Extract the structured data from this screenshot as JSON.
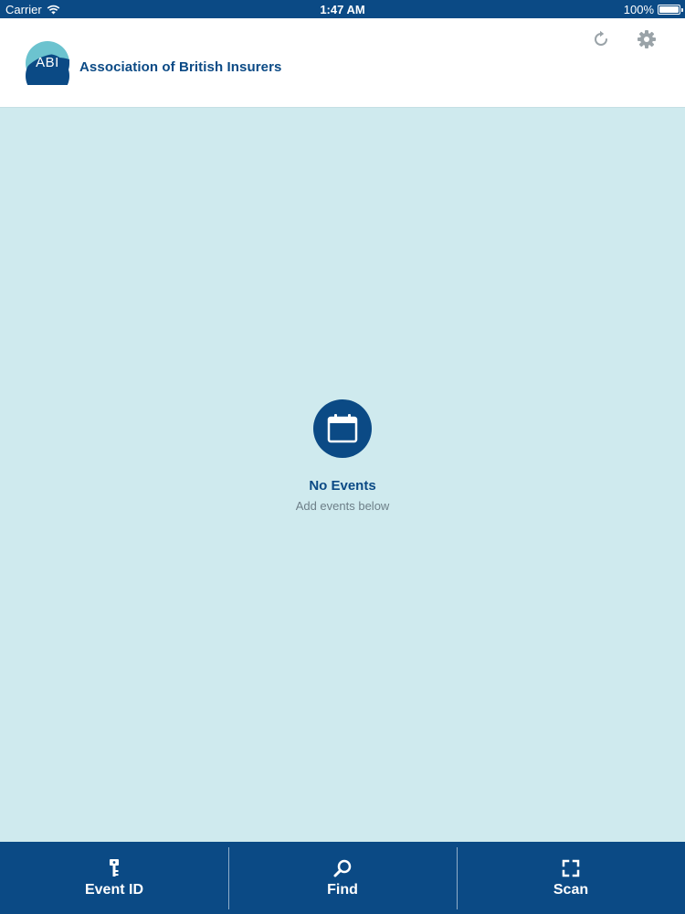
{
  "status_bar": {
    "carrier": "Carrier",
    "time": "1:47 AM",
    "battery": "100%"
  },
  "header": {
    "logo_text": "ABI",
    "brand_name": "Association of British Insurers",
    "icons": [
      "refresh-icon",
      "gear-icon"
    ]
  },
  "empty_state": {
    "icon": "calendar-icon",
    "title": "No Events",
    "subtitle": "Add events below"
  },
  "tab_bar": {
    "tabs": [
      {
        "label": "Event ID",
        "icon": "key-icon"
      },
      {
        "label": "Find",
        "icon": "search-icon"
      },
      {
        "label": "Scan",
        "icon": "scan-frame-icon"
      }
    ]
  },
  "colors": {
    "brand_navy": "#0b4a85",
    "background": "#cfeaee",
    "logo_light": "#6cc3cf"
  }
}
